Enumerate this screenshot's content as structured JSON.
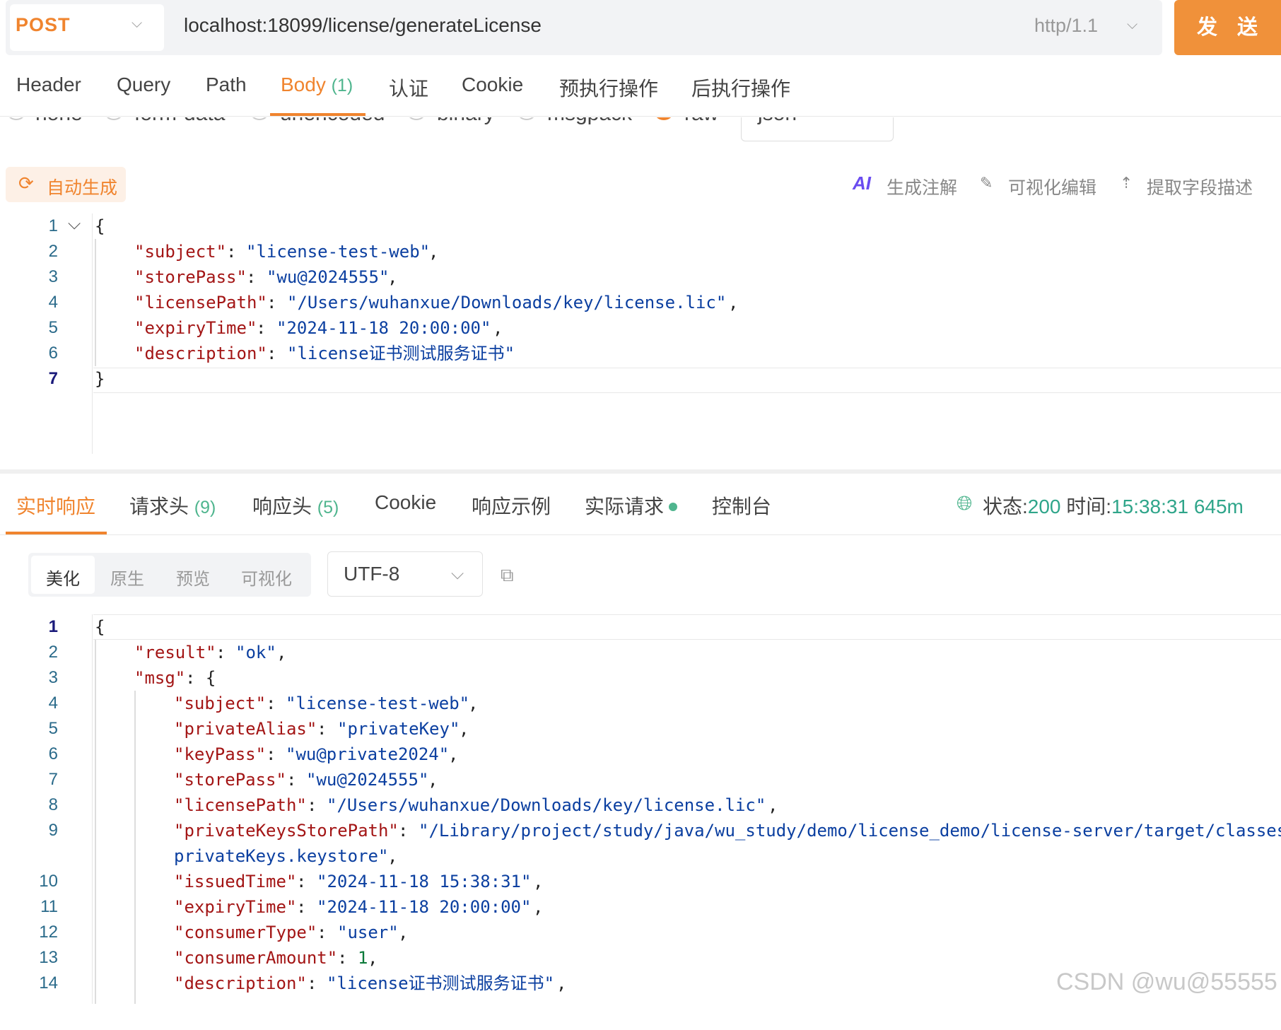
{
  "request": {
    "method": "POST",
    "url": "localhost:18099/license/generateLicense",
    "protocol": "http/1.1",
    "send_label": "发 送"
  },
  "request_tabs": [
    {
      "label": "Header"
    },
    {
      "label": "Query"
    },
    {
      "label": "Path"
    },
    {
      "label": "Body",
      "count": "(1)",
      "active": true
    },
    {
      "label": "认证"
    },
    {
      "label": "Cookie"
    },
    {
      "label": "预执行操作"
    },
    {
      "label": "后执行操作"
    }
  ],
  "body_types": [
    "none",
    "form-data",
    "urlencoded",
    "binary",
    "msgpack",
    "raw"
  ],
  "body_format": "json",
  "toolbar": {
    "auto_generate": "自动生成",
    "generate_comment": "生成注解",
    "visual_edit": "可视化编辑",
    "extract_fields": "提取字段描述"
  },
  "request_body": [
    "{",
    "\"subject\": \"license-test-web\",",
    "\"storePass\": \"wu@2024555\",",
    "\"licensePath\": \"/Users/wuhanxue/Downloads/key/license.lic\",",
    "\"expiryTime\": \"2024-11-18 20:00:00\",",
    "\"description\": \"license证书测试服务证书\"",
    "}"
  ],
  "response_tabs": [
    {
      "label": "实时响应",
      "active": true
    },
    {
      "label": "请求头",
      "count": "(9)"
    },
    {
      "label": "响应头",
      "count": "(5)"
    },
    {
      "label": "Cookie"
    },
    {
      "label": "响应示例"
    },
    {
      "label": "实际请求"
    },
    {
      "label": "控制台"
    }
  ],
  "status": {
    "status_label": "状态:",
    "status_value": "200",
    "time_label": "时间:",
    "time_value": "15:38:31 645m"
  },
  "view_modes": [
    "美化",
    "原生",
    "预览",
    "可视化"
  ],
  "encoding": "UTF-8",
  "response_body": {
    "result": "ok",
    "subject": "license-test-web",
    "privateAlias": "privateKey",
    "keyPass": "wu@private2024",
    "storePass": "wu@2024555",
    "licensePath": "/Users/wuhanxue/Downloads/key/license.lic",
    "privateKeysStorePath_1": "/Library/project/study/java/wu_study/demo/license_demo/license-server/target/classes",
    "privateKeysStorePath_2": "privateKeys.keystore",
    "issuedTime": "2024-11-18 15:38:31",
    "expiryTime": "2024-11-18 20:00:00",
    "consumerType": "user",
    "consumerAmount": "1",
    "description": "license证书测试服务证书"
  },
  "watermark": "CSDN @wu@55555",
  "colors": {
    "accent": "#f0842e",
    "send_button": "#f0913a",
    "count_green": "#4fb58e",
    "json_key": "#a31515",
    "json_string": "#0b3fa0"
  }
}
